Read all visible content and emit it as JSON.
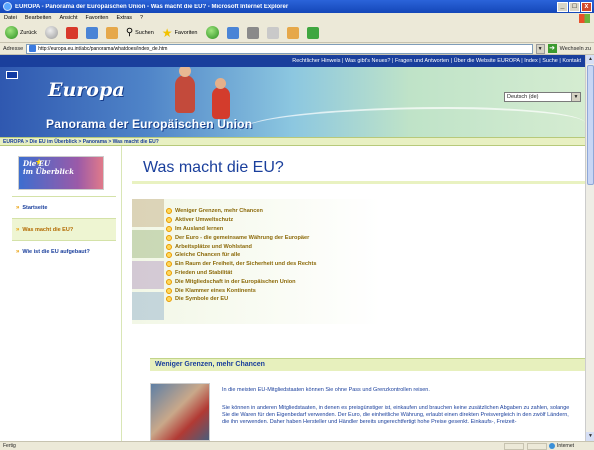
{
  "window": {
    "title": "EUROPA - Panorama der Europäischen Union - Was macht die EU? - Microsoft Internet Explorer",
    "minimize": "_",
    "maximize": "□",
    "close": "x"
  },
  "menu": [
    "Datei",
    "Bearbeiten",
    "Ansicht",
    "Favoriten",
    "Extras",
    "?"
  ],
  "toolbar": {
    "back": "Zurück",
    "search": "Suchen",
    "favorites": "Favoriten"
  },
  "address": {
    "label": "Adresse",
    "url": "http://europa.eu.int/abc/panorama/whatdoes/index_de.htm",
    "go": "Wechseln zu"
  },
  "site": {
    "topnav": [
      "Rechtlicher Hinweis",
      "Was gibt's Neues?",
      "Fragen und Antworten",
      "Über die Website EUROPA",
      "Index",
      "Suche",
      "Kontakt"
    ],
    "logo": "Europa",
    "subtitle": "Panorama der Europäischen Union",
    "language": "Deutsch (de)",
    "breadcrumb": "EUROPA > Die EU im Überblick > Panorama > Was macht die EU?"
  },
  "sidebar": {
    "image_title_line1": "Die EU",
    "image_title_line2": "im Überblick",
    "items": [
      {
        "label": "Startseite",
        "active": false
      },
      {
        "label": "Was macht die EU?",
        "active": true
      },
      {
        "label": "Wie ist die EU aufgebaut?",
        "active": false
      }
    ]
  },
  "main": {
    "title": "Was macht die EU?",
    "toc": [
      "Weniger Grenzen, mehr Chancen",
      "Aktiver Umweltschutz",
      "Im Ausland lernen",
      "Der Euro - die gemeinsame Währung der Europäer",
      "Arbeitsplätze und Wohlstand",
      "Gleiche Chancen für alle",
      "Ein Raum der Freiheit, der Sicherheit und des Rechts",
      "Frieden und Stabilität",
      "Die Mitgliedschaft in der Europäischen Union",
      "Die Klammer eines Kontinents",
      "Die Symbole der EU"
    ],
    "section_title": "Weniger Grenzen, mehr Chancen",
    "para1": "In die meisten EU-Mitgliedstaaten können Sie ohne Pass und Grenzkontrollen reisen.",
    "para2": "Sie können in anderen Mitgliedstaaten, in denen es preisgünstiger ist, einkaufen und brauchen keine zusätzlichen Abgaben zu zahlen, solange Sie die Waren für den Eigenbedarf verwenden. Der Euro, die einheitliche Währung, erlaubt einen direkten Preisvergleich in den zwölf Ländern, die ihn verwenden. Daher haben Hersteller und Händler bereits ungerechtfertigt hohe Preise gesenkt. Einkaufs-, Freizeit-"
  },
  "status": {
    "left": "Fertig",
    "zone": "Internet"
  }
}
